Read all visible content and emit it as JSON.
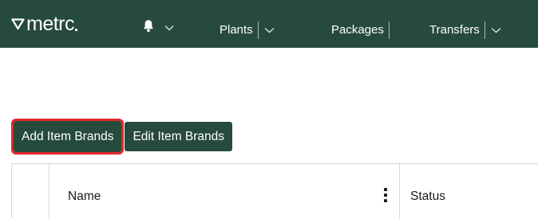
{
  "brand": {
    "logo_text": "metrc",
    "colors": {
      "nav_background": "#264a3c",
      "button_background": "#264a3c",
      "highlight_outline": "#e0262c"
    }
  },
  "navbar": {
    "notifications_icon": "bell-icon",
    "items": [
      {
        "label": "Plants",
        "has_dropdown": true
      },
      {
        "label": "Packages",
        "has_dropdown": false
      },
      {
        "label": "Transfers",
        "has_dropdown": true
      }
    ]
  },
  "toolbar": {
    "add_label": "Add Item Brands",
    "edit_label": "Edit Item Brands"
  },
  "grid": {
    "columns": [
      {
        "label": ""
      },
      {
        "label": "Name"
      },
      {
        "label": "Status"
      }
    ]
  }
}
